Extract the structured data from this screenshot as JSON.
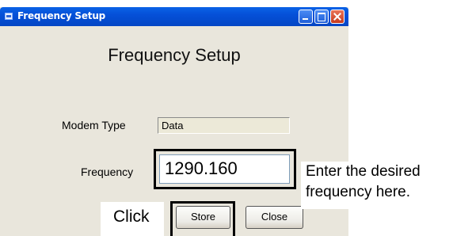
{
  "window": {
    "title": "Frequency Setup",
    "heading": "Frequency Setup"
  },
  "form": {
    "modem_type_label": "Modem Type",
    "modem_type_value": "Data",
    "frequency_label": "Frequency",
    "frequency_value": "1290.160"
  },
  "buttons": {
    "store_label": "Store",
    "close_label": "Close"
  },
  "annotations": {
    "click_label": "Click",
    "callout_line1": "Enter the desired",
    "callout_line2": "frequency here."
  },
  "colors": {
    "titlebar": "#0550d8",
    "window_bg": "#e9e6dc"
  }
}
